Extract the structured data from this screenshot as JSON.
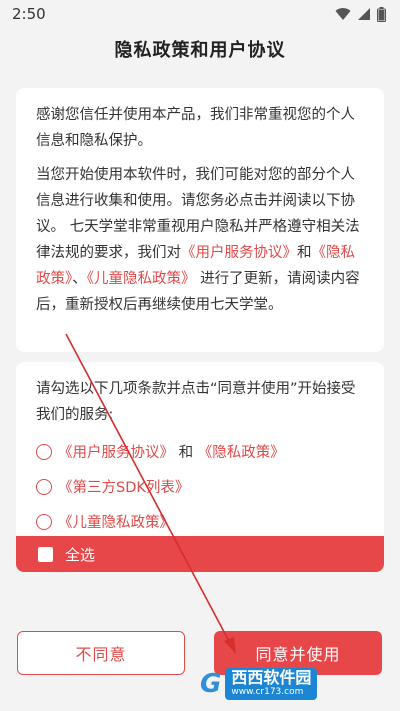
{
  "status_bar": {
    "time": "2:50",
    "icons": [
      "wifi-icon",
      "signal-icon",
      "battery-icon"
    ]
  },
  "title": "隐私政策和用户协议",
  "intro": {
    "p1": "感谢您信任并使用本产品，我们非常重视您的个人信息和隐私保护。",
    "p2_a": "当您开始使用本软件时，我们可能对您的部分个人信息进行收集和使用。请您务必点击并阅读以下协议。 七天学堂非常重视用户隐私并严格遵守相关法律法规的要求，我们对",
    "p2_link1": "《用户服务协议》",
    "p2_b": "和",
    "p2_link2": "《隐私政策》",
    "p2_c": "、",
    "p2_link3": "《儿童隐私政策》",
    "p2_d": " 进行了更新，请阅读内容后，重新授权后再继续使用七天学堂。"
  },
  "consent": {
    "instruction": "请勾选以下几项条款并点击“同意并使用”开始接受我们的服务:",
    "items": [
      {
        "link_a": "《用户服务协议》",
        "join": " 和 ",
        "link_b": "《隐私政策》"
      },
      {
        "link_a": "《第三方SDK列表》"
      },
      {
        "link_a": "《儿童隐私政策》"
      }
    ],
    "select_all_label": "全选"
  },
  "buttons": {
    "disagree": "不同意",
    "agree": "同意并使用"
  },
  "watermark": {
    "logo": "G",
    "name": "西西软件园",
    "url": "www.cr173.com"
  },
  "colors": {
    "accent": "#e8474a",
    "link": "#e04a4a",
    "background": "#f3f3f3",
    "card": "#ffffff",
    "watermark": "#1d86d4"
  }
}
